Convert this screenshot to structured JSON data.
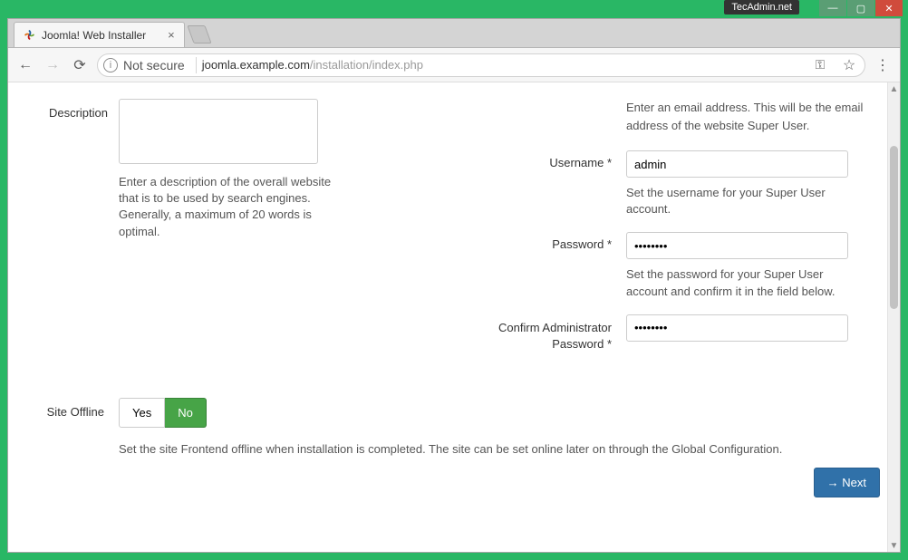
{
  "window": {
    "watermark": "TecAdmin.net"
  },
  "browser": {
    "tab_title": "Joomla! Web Installer",
    "not_secure": "Not secure",
    "url_domain": "joomla.example.com",
    "url_path": "/installation/index.php"
  },
  "form": {
    "description_label": "Description",
    "description_value": "",
    "description_help": "Enter a description of the overall website that is to be used by search engines. Generally, a maximum of 20 words is optimal.",
    "email_help": "Enter an email address. This will be the email address of the website Super User.",
    "username_label": "Username *",
    "username_value": "admin",
    "username_help": "Set the username for your Super User account.",
    "password_label": "Password *",
    "password_value": "••••••••",
    "password_help": "Set the password for your Super User account and confirm it in the field below.",
    "confirm_label": "Confirm Administrator Password *",
    "confirm_value": "••••••••",
    "site_offline_label": "Site Offline",
    "yes": "Yes",
    "no": "No",
    "site_offline_help": "Set the site Frontend offline when installation is completed. The site can be set online later on through the Global Configuration.",
    "next": "Next"
  }
}
